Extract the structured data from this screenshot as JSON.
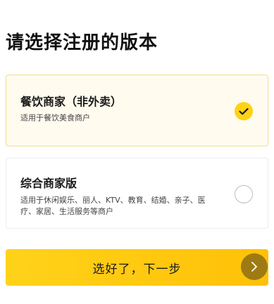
{
  "page": {
    "title": "请选择注册的版本"
  },
  "options": [
    {
      "name": "餐饮商家（非外卖）",
      "description": "适用于餐饮美食商户",
      "selected": true
    },
    {
      "name": "综合商家版",
      "description": "适用于休闲娱乐、丽人、KTV、教育、结婚、亲子、医疗、家居、生活服务等商户",
      "selected": false
    }
  ],
  "submit": {
    "label": "选好了，下一步",
    "icon": "chevron-right-icon"
  },
  "colors": {
    "accent": "#ffd215",
    "selected_card_bg": "#fffbee",
    "selected_card_border": "#f3dc8a",
    "arrow_circle": "#9e7a12"
  }
}
